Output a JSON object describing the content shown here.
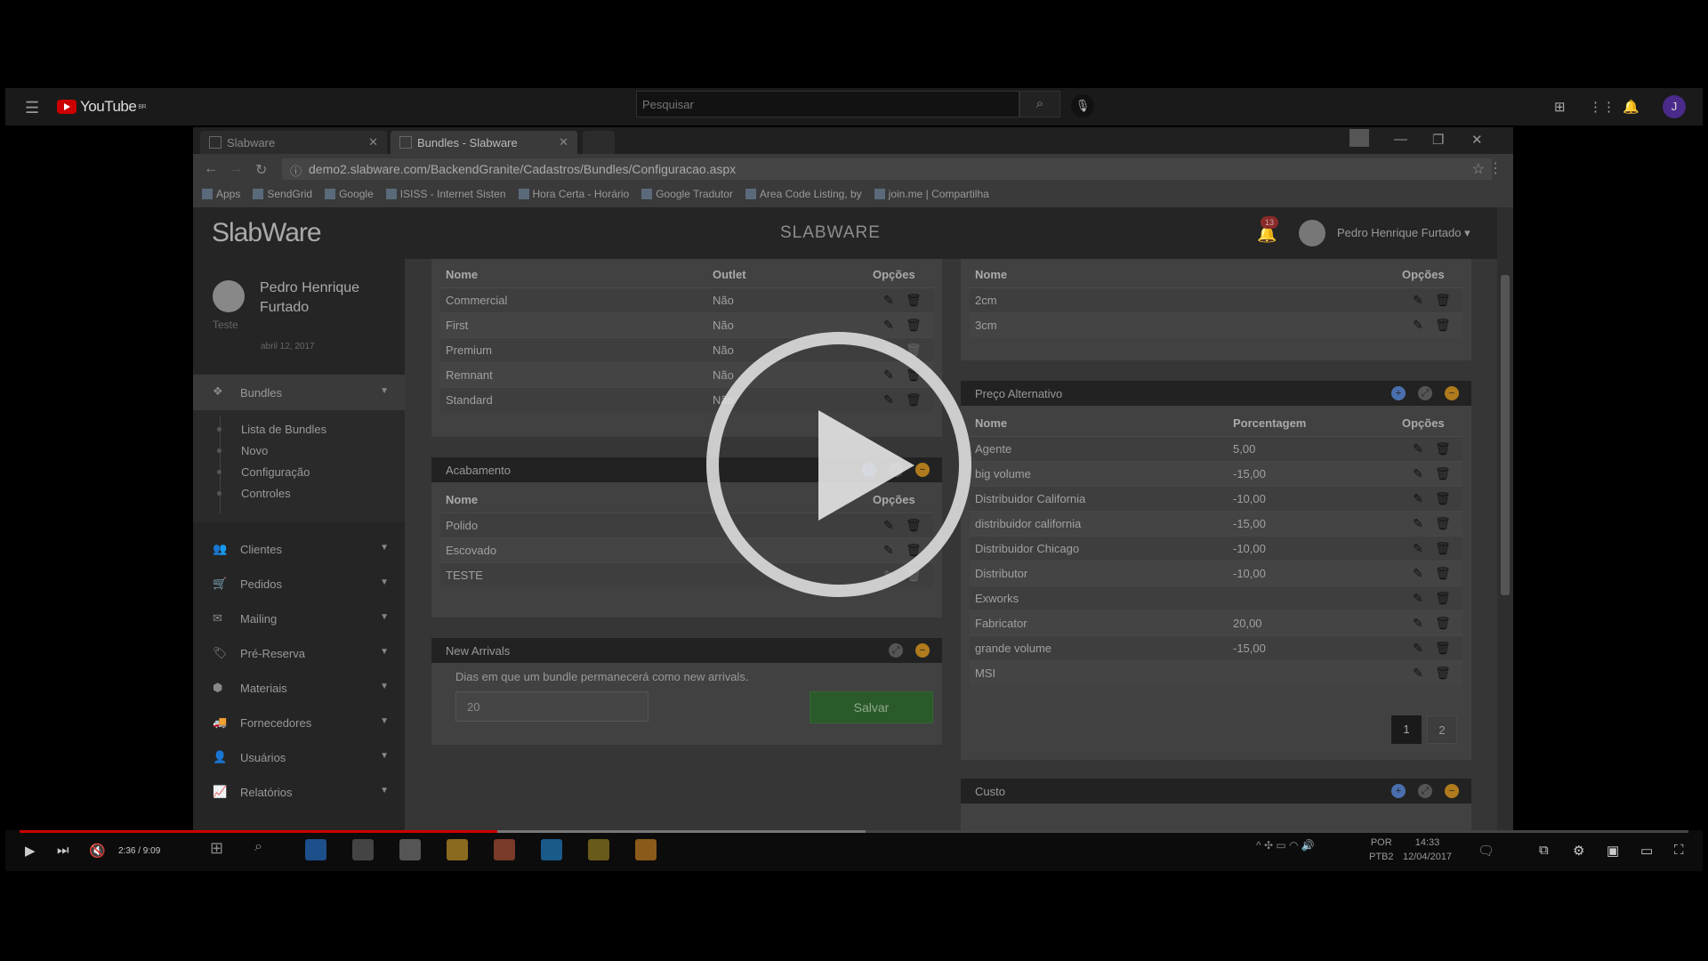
{
  "youtube": {
    "logo_text": "YouTube",
    "logo_region": "BR",
    "search_placeholder": "Pesquisar",
    "avatar_letter": "J",
    "icons": [
      "menu-icon",
      "search-icon",
      "mic-icon",
      "upload-icon",
      "apps-icon",
      "bell-icon"
    ]
  },
  "browser": {
    "tabs": [
      {
        "title": "Slabware",
        "active": false
      },
      {
        "title": "Bundles - Slabware",
        "active": true
      }
    ],
    "url": "demo2.slabware.com/BackendGranite/Cadastros/Bundles/Configuracao.aspx",
    "bookmarks": [
      "Apps",
      "SendGrid",
      "Google",
      "ISISS - Internet Sisten",
      "Hora Certa - Horário",
      "Google Tradutor",
      "Area Code Listing, by",
      "join.me | Compartilha"
    ]
  },
  "app": {
    "logo": "SlabWare",
    "title": "SLABWARE",
    "notification_count": "13",
    "user_name": "Pedro Henrique Furtado"
  },
  "sidebar": {
    "profile_name": "Pedro Henrique Furtado",
    "profile_role": "Teste",
    "profile_date": "abril 12, 2017",
    "active_menu": "Bundles",
    "submenu": [
      "Lista de Bundles",
      "Novo",
      "Configuração",
      "Controles"
    ],
    "menu": [
      {
        "label": "Clientes",
        "icon": "users-icon"
      },
      {
        "label": "Pedidos",
        "icon": "cart-icon"
      },
      {
        "label": "Mailing",
        "icon": "mail-icon"
      },
      {
        "label": "Pré-Reserva",
        "icon": "tags-icon"
      },
      {
        "label": "Materiais",
        "icon": "cube-icon"
      },
      {
        "label": "Fornecedores",
        "icon": "truck-icon"
      },
      {
        "label": "Usuários",
        "icon": "user-icon"
      },
      {
        "label": "Relatórios",
        "icon": "chart-icon"
      }
    ]
  },
  "grades": {
    "headers": {
      "name": "Nome",
      "outlet": "Outlet",
      "options": "Opções"
    },
    "rows": [
      {
        "name": "Commercial",
        "outlet": "Não"
      },
      {
        "name": "First",
        "outlet": "Não"
      },
      {
        "name": "Premium",
        "outlet": "Não"
      },
      {
        "name": "Remnant",
        "outlet": "Não"
      },
      {
        "name": "Standard",
        "outlet": "Não"
      }
    ]
  },
  "thickness": {
    "headers": {
      "name": "Nome",
      "options": "Opções"
    },
    "rows": [
      {
        "name": "2cm"
      },
      {
        "name": "3cm"
      }
    ]
  },
  "acabamento": {
    "title": "Acabamento",
    "headers": {
      "name": "Nome",
      "options": "Opções"
    },
    "rows": [
      {
        "name": "Polido"
      },
      {
        "name": "Escovado"
      },
      {
        "name": "TESTE"
      }
    ]
  },
  "new_arrivals": {
    "title": "New Arrivals",
    "description": "Dias em que um bundle permanecerá como new arrivals.",
    "value": "20",
    "save_label": "Salvar"
  },
  "preco_alternativo": {
    "title": "Preço Alternativo",
    "headers": {
      "name": "Nome",
      "percent": "Porcentagem",
      "options": "Opções"
    },
    "rows": [
      {
        "name": "Agente",
        "percent": "5,00"
      },
      {
        "name": "big volume",
        "percent": "-15,00"
      },
      {
        "name": "Distribuidor California",
        "percent": "-10,00"
      },
      {
        "name": "distribuidor california",
        "percent": "-15,00"
      },
      {
        "name": "Distribuidor Chicago",
        "percent": "-10,00"
      },
      {
        "name": "Distributor",
        "percent": "-10,00"
      },
      {
        "name": "Exworks",
        "percent": ""
      },
      {
        "name": "Fabricator",
        "percent": "20,00"
      },
      {
        "name": "grande volume",
        "percent": "-15,00"
      },
      {
        "name": "MSI",
        "percent": ""
      }
    ],
    "pages": [
      "1",
      "2"
    ]
  },
  "custo": {
    "title": "Custo"
  },
  "player": {
    "time": "2:36 / 9:09",
    "progress_played": 0.286,
    "progress_buffered": 0.507
  },
  "taskbar": {
    "lang_line1": "POR",
    "lang_line2": "PTB2",
    "clock_time": "14:33",
    "clock_date": "12/04/2017"
  },
  "colors": {
    "save_button": "#2a5a2a",
    "ctrl_add": "#4a6fae",
    "ctrl_collapse": "#b07b1d",
    "progress": "#cc0000"
  }
}
